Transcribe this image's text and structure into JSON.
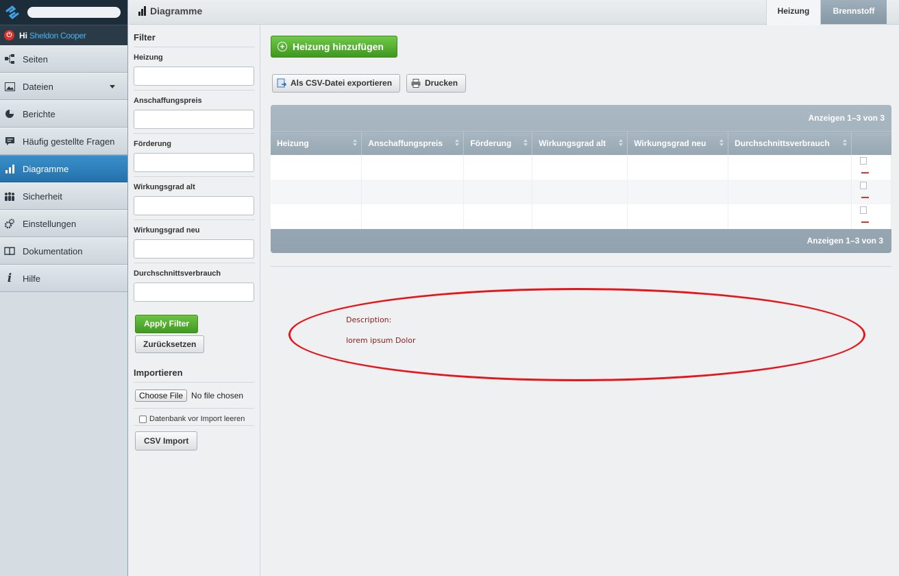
{
  "user": {
    "greeting": "Hi",
    "name": "Sheldon Cooper"
  },
  "nav": {
    "items": [
      {
        "label": "Seiten",
        "icon": "sitemap-icon"
      },
      {
        "label": "Dateien",
        "icon": "image-icon"
      },
      {
        "label": "Berichte",
        "icon": "pie-chart-icon"
      },
      {
        "label": "Häufig gestellte Fragen",
        "icon": "speech-bubble-icon"
      },
      {
        "label": "Diagramme",
        "icon": "bar-chart-icon",
        "active": true
      },
      {
        "label": "Sicherheit",
        "icon": "users-icon"
      },
      {
        "label": "Einstellungen",
        "icon": "gears-icon"
      },
      {
        "label": "Dokumentation",
        "icon": "book-icon"
      },
      {
        "label": "Hilfe",
        "icon": "info-icon"
      }
    ]
  },
  "header": {
    "title": "Diagramme",
    "tabs": [
      {
        "label": "Heizung",
        "active": true
      },
      {
        "label": "Brennstoff",
        "active": false
      }
    ]
  },
  "filter": {
    "title": "Filter",
    "fields": [
      {
        "label": "Heizung",
        "value": ""
      },
      {
        "label": "Anschaffungspreis",
        "value": ""
      },
      {
        "label": "Förderung",
        "value": ""
      },
      {
        "label": "Wirkungsgrad alt",
        "value": ""
      },
      {
        "label": "Wirkungsgrad neu",
        "value": ""
      },
      {
        "label": "Durchschnittsverbrauch",
        "value": ""
      }
    ],
    "apply_label": "Apply Filter",
    "reset_label": "Zurücksetzen"
  },
  "import": {
    "title": "Importieren",
    "file_button": "Choose File",
    "file_status": "No file chosen",
    "clear_db_label": "Datenbank vor Import leeren",
    "clear_db_checked": false,
    "csv_import_label": "CSV Import"
  },
  "main": {
    "add_button": "Heizung hinzufügen",
    "export_button": "Als CSV-Datei exportieren",
    "print_button": "Drucken",
    "grid": {
      "info_top": "Anzeigen 1–3 von 3",
      "info_bottom": "Anzeigen 1–3 von 3",
      "columns": [
        "Heizung",
        "Anschaffungspreis",
        "Förderung",
        "Wirkungsgrad alt",
        "Wirkungsgrad neu",
        "Durchschnittsverbrauch"
      ]
    },
    "description_label": "Description:",
    "description_text": "lorem ipsum Dolor"
  },
  "colors": {
    "accent_blue": "#2471ac",
    "green": "#3f9a1f",
    "annotation_red": "#e8141a"
  }
}
